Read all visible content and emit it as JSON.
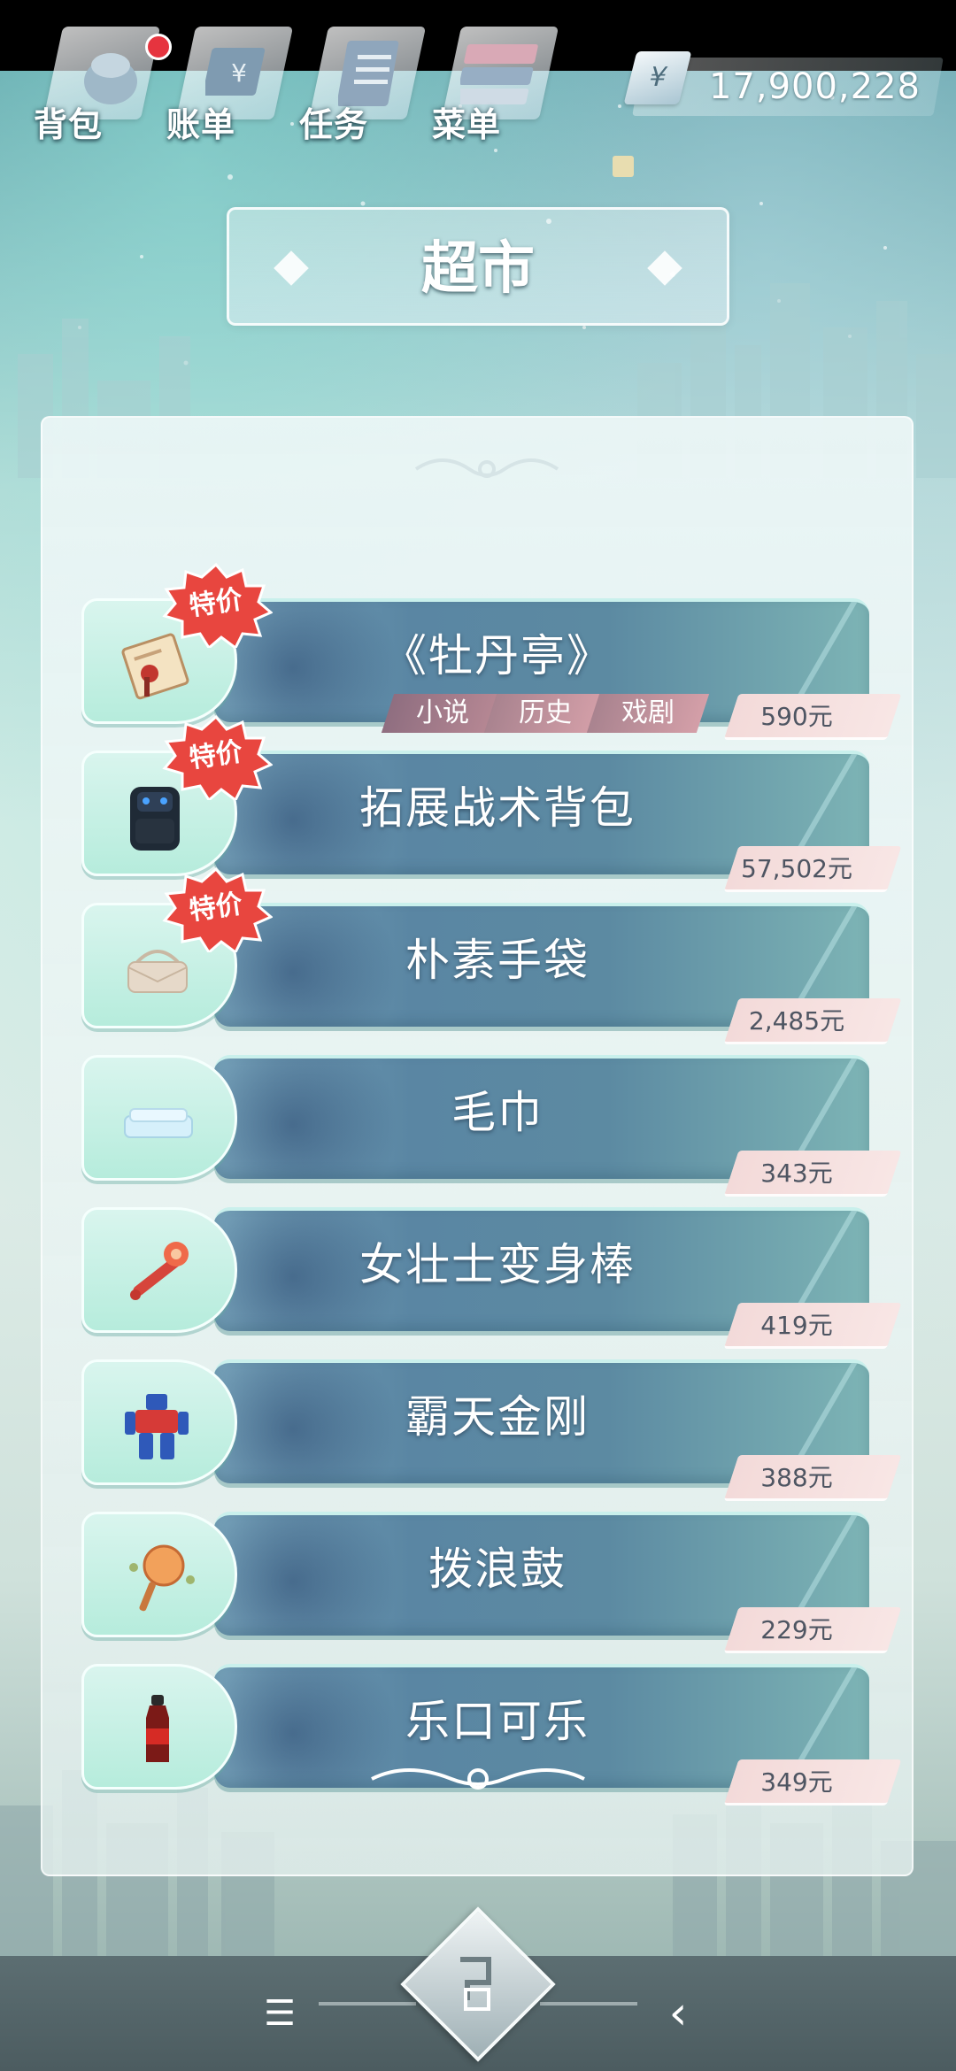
{
  "topbar": {
    "items": [
      {
        "label": "背包",
        "icon": "backpack-icon",
        "has_badge": true
      },
      {
        "label": "账单",
        "icon": "bill-icon",
        "has_badge": false
      },
      {
        "label": "任务",
        "icon": "task-list-icon",
        "has_badge": false
      },
      {
        "label": "菜单",
        "icon": "menu-cards-icon",
        "has_badge": false
      }
    ],
    "money": {
      "symbol": "¥",
      "value": "17,900,228"
    }
  },
  "title": "超市",
  "sale_label": "特价",
  "items": [
    {
      "name": "《牡丹亭》",
      "price": "590元",
      "sale": true,
      "icon": "book-icon",
      "tags": [
        "小说",
        "历史",
        "戏剧"
      ]
    },
    {
      "name": "拓展战术背包",
      "price": "57,502元",
      "sale": true,
      "icon": "tactical-backpack-icon"
    },
    {
      "name": "朴素手袋",
      "price": "2,485元",
      "sale": true,
      "icon": "handbag-icon"
    },
    {
      "name": "毛巾",
      "price": "343元",
      "sale": false,
      "icon": "towel-icon"
    },
    {
      "name": "女壮士变身棒",
      "price": "419元",
      "sale": false,
      "icon": "magic-wand-icon"
    },
    {
      "name": "霸天金刚",
      "price": "388元",
      "sale": false,
      "icon": "robot-toy-icon"
    },
    {
      "name": "拨浪鼓",
      "price": "229元",
      "sale": false,
      "icon": "rattle-drum-icon"
    },
    {
      "name": "乐口可乐",
      "price": "349元",
      "sale": false,
      "icon": "cola-bottle-icon"
    }
  ],
  "navbar": {
    "menu_glyph": "☰",
    "back_glyph": "‹"
  },
  "colors": {
    "sale_badge": "#e8463f",
    "price_tag": "#f3dad9",
    "bar": "#5a86a3",
    "icon_slot": "#c4efe3"
  }
}
